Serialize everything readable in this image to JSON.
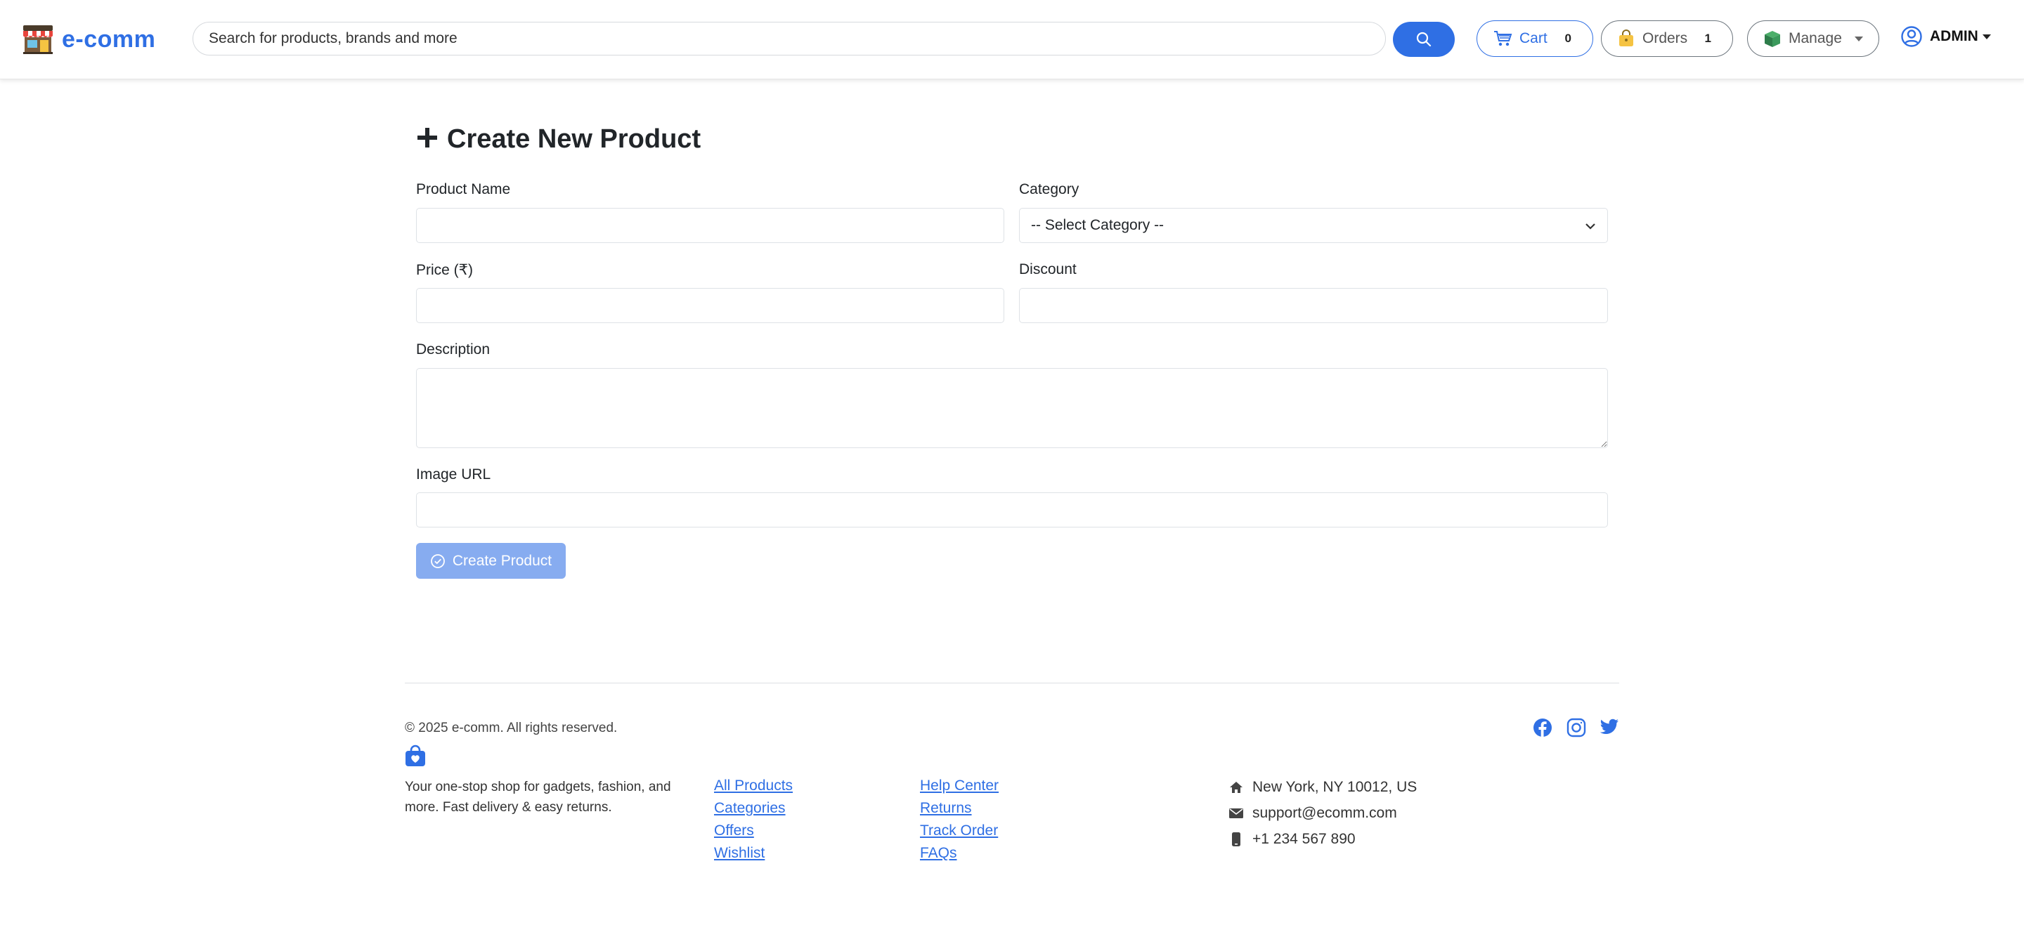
{
  "colors": {
    "primary": "#2f6fe4",
    "disabled_primary": "#87acf0",
    "border": "#dee2e6"
  },
  "navbar": {
    "brand": "e-comm",
    "brand_icon": "storefront-icon",
    "search_placeholder": "Search for products, brands and more",
    "search_icon": "search-icon",
    "cart": {
      "label": "Cart",
      "count": "0",
      "icon": "cart-icon"
    },
    "orders": {
      "label": "Orders",
      "count": "1",
      "icon": "shopping-bag-icon"
    },
    "manage": {
      "label": "Manage",
      "icon": "package-icon"
    },
    "user": {
      "label": "ADMIN",
      "icon": "user-circle-icon"
    }
  },
  "form": {
    "title": "Create New Product",
    "title_icon": "plus-icon",
    "product_name_label": "Product Name",
    "product_name_value": "",
    "category_label": "Category",
    "category_selected": "-- Select Category --",
    "price_label": "Price (₹)",
    "price_value": "",
    "discount_label": "Discount",
    "discount_value": "",
    "description_label": "Description",
    "description_value": "",
    "image_url_label": "Image URL",
    "image_url_value": "",
    "submit_label": "Create Product",
    "submit_icon": "check-circle-icon"
  },
  "footer": {
    "copyright": "© 2025 e-comm. All rights reserved.",
    "logo_icon": "shopping-bag-heart-icon",
    "tagline": "Your one-stop shop for gadgets, fashion, and more. Fast delivery & easy returns.",
    "shop_links": [
      "All Products",
      "Categories",
      "Offers",
      "Wishlist"
    ],
    "help_links": [
      "Help Center",
      "Returns",
      "Track Order",
      "FAQs"
    ],
    "contact": {
      "address": "New York, NY 10012, US",
      "email": "support@ecomm.com",
      "phone": "+1 234 567 890"
    },
    "social": [
      "facebook-icon",
      "instagram-icon",
      "twitter-icon"
    ]
  }
}
